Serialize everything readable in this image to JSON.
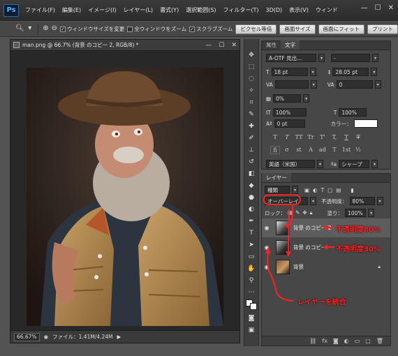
{
  "menubar": {
    "logo": "Ps",
    "items": [
      "ファイル(F)",
      "編集(E)",
      "イメージ(I)",
      "レイヤー(L)",
      "書式(Y)",
      "選択範囲(S)",
      "フィルター(T)",
      "3D(D)",
      "表示(V)",
      "ウィンド"
    ]
  },
  "options": {
    "resize_windows": "ウィンドウサイズを変更",
    "zoom_all": "全ウィンドウをズーム",
    "scrubby_zoom": "スクラブズーム",
    "actual_pixels": "ピクセル等倍",
    "screen_size": "画面サイズ",
    "fit_screen": "画面にフィット",
    "print_size": "プリント"
  },
  "document": {
    "title": "man.png @ 66.7% (背景 のコピー 2, RGB/8) *",
    "zoom": "66.67%",
    "file_info": "ファイル：1.41M/4.24M"
  },
  "character": {
    "tabs": [
      "属性",
      "文字"
    ],
    "font": "A-OTF 見出...",
    "font_style": "-",
    "size": "18 pt",
    "leading": "28.05 pt",
    "kerning": "",
    "tracking": "0",
    "tsume": "0%",
    "vscale": "100%",
    "hscale": "100%",
    "baseline": "0 pt",
    "color_label": "カラー：",
    "type_buttons": [
      "T",
      "T",
      "TT",
      "Tr",
      "T'",
      "T,",
      "T",
      "T"
    ],
    "ot_buttons": [
      "fi",
      "σ",
      "st",
      "A",
      "ad",
      "T",
      "1st",
      "½"
    ],
    "language": "英語（米国）",
    "antialias": "シャープ"
  },
  "layers": {
    "tab": "レイヤー",
    "filter": "種類",
    "blend_mode": "オーバーレイ",
    "opacity_label": "不透明度：",
    "opacity": "80%",
    "lock_label": "ロック：",
    "fill_label": "塗り：",
    "fill": "100%",
    "rows": [
      {
        "name": "背景 のコピー 2"
      },
      {
        "name": "背景 のコピー"
      },
      {
        "name": "背景"
      }
    ]
  },
  "annotations": {
    "top": "不透明度80%",
    "mid": "不透明度30%",
    "merge": "レイヤーを統合"
  },
  "colors": {
    "annotation": "#ff2020",
    "panel": "#474747"
  }
}
